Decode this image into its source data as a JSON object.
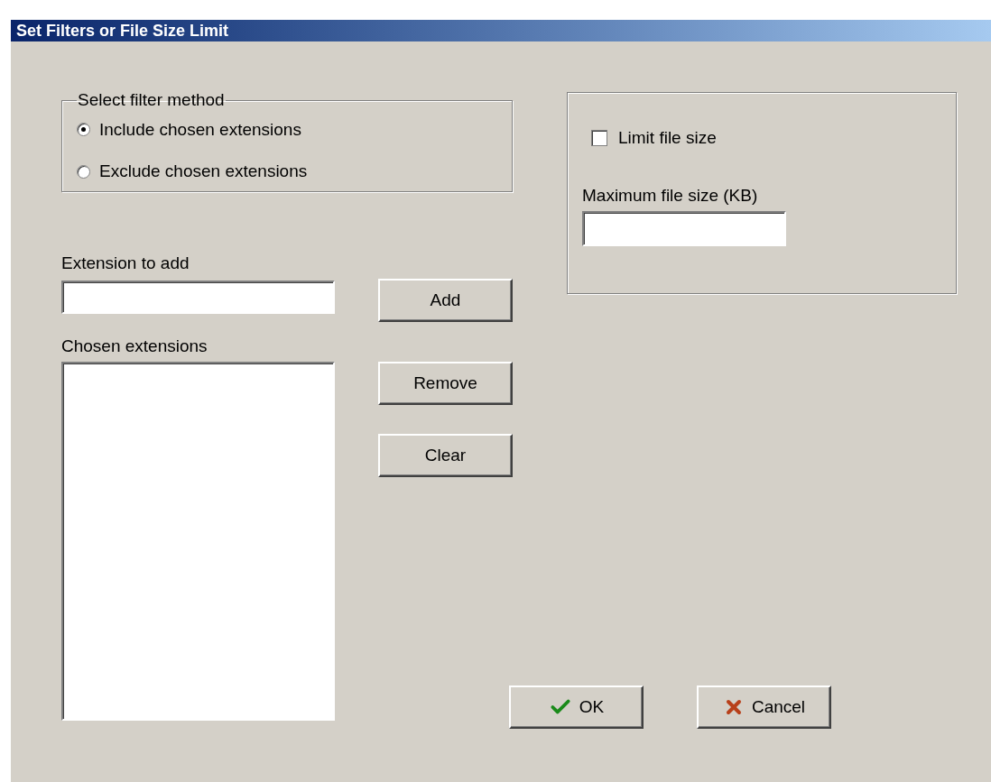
{
  "window": {
    "title": "Set Filters or File Size Limit"
  },
  "filter_method": {
    "label": "Select filter method",
    "options": [
      {
        "label": "Include chosen extensions",
        "selected": true
      },
      {
        "label": "Exclude chosen extensions",
        "selected": false
      }
    ]
  },
  "size_limit": {
    "checkbox": {
      "label": "Limit file size",
      "checked": false
    },
    "max_size_label": "Maximum file size (KB)"
  },
  "extension_label": "Extension to add",
  "add_button": "Add",
  "chosen_label": "Chosen extensions",
  "list_buttons": [
    "Remove",
    "Clear"
  ],
  "dialog_buttons": [
    {
      "label": "OK",
      "kind": "ok"
    },
    {
      "label": "Cancel",
      "kind": "cancel"
    }
  ]
}
